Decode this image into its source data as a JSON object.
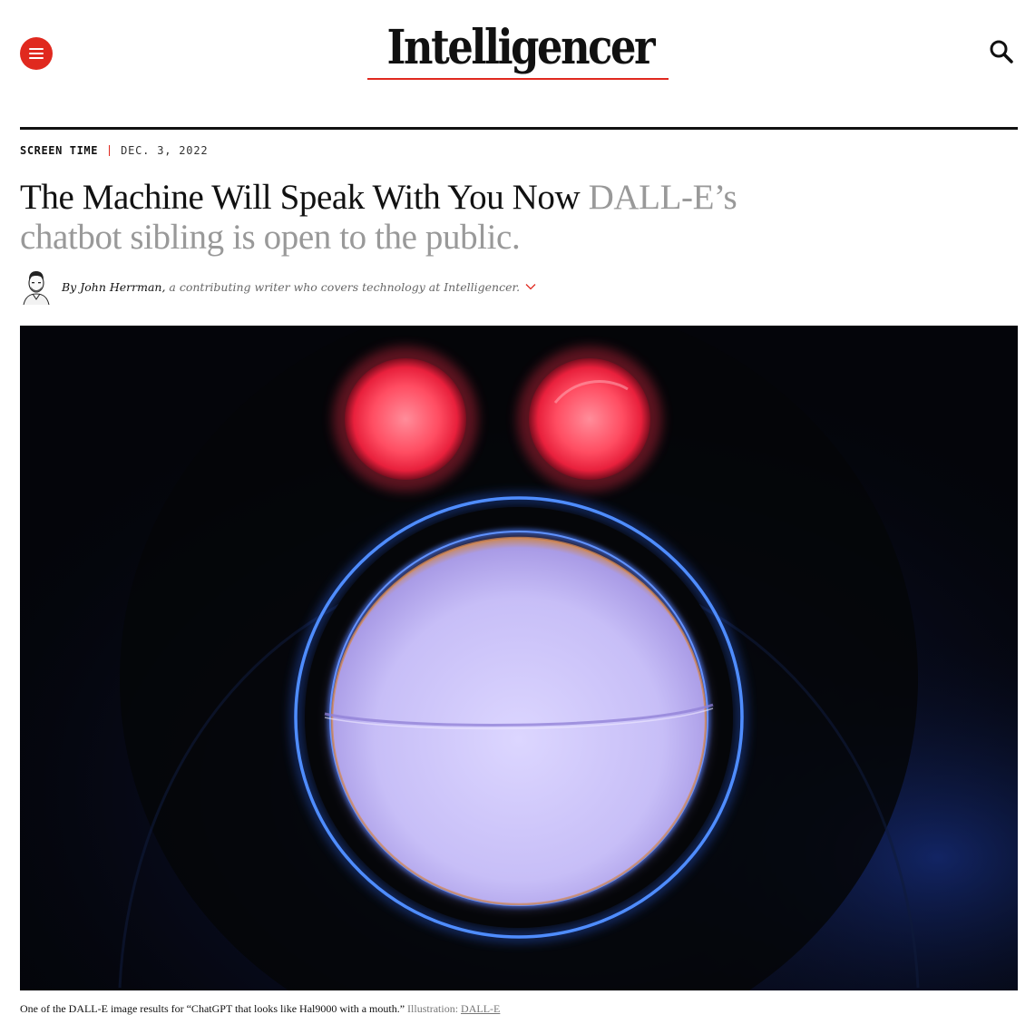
{
  "header": {
    "menu_icon": "hamburger-menu-icon",
    "logo_text": "Intelligencer",
    "search_icon": "search-icon",
    "brand_red": "#e0291f"
  },
  "rubric": {
    "section": "Screen Time",
    "date": "Dec. 3, 2022"
  },
  "article": {
    "headline": "The Machine Will Speak With You Now",
    "dek": "DALL-E’s chatbot sibling is open to the public."
  },
  "byline": {
    "prefix": "By",
    "author": "John Herrman,",
    "bio": "a contributing writer who covers technology at Intelligencer.",
    "toggle_icon": "chevron-down-icon"
  },
  "hero": {
    "description_icon": "robot-face-illustration"
  },
  "caption": {
    "text": "One of the DALL-E image results for “ChatGPT that looks like Hal9000 with a mouth.”",
    "credit_label": "Illustration:",
    "credit_link": "DALL-E"
  }
}
